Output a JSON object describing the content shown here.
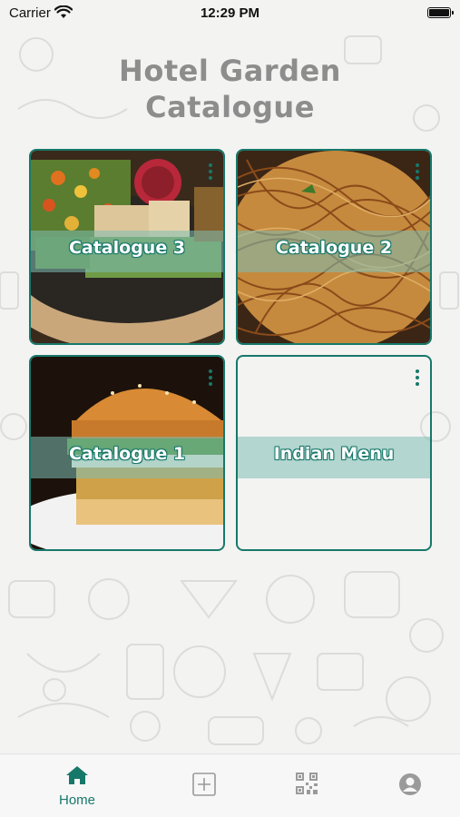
{
  "status_bar": {
    "carrier": "Carrier",
    "time": "12:29 PM"
  },
  "header": {
    "title_line1": "Hotel Garden",
    "title_line2": "Catalogue"
  },
  "catalogues": [
    {
      "label": "Catalogue 3",
      "image": "grilled-vegetable-platter"
    },
    {
      "label": "Catalogue 2",
      "image": "noodles"
    },
    {
      "label": "Catalogue 1",
      "image": "veggie-burger"
    },
    {
      "label": "Indian Menu",
      "image": "none"
    }
  ],
  "tabbar": {
    "items": [
      {
        "label": "Home",
        "icon": "home-icon",
        "active": true
      },
      {
        "label": "",
        "icon": "add-square-icon",
        "active": false
      },
      {
        "label": "",
        "icon": "qr-code-icon",
        "active": false
      },
      {
        "label": "",
        "icon": "profile-icon",
        "active": false
      }
    ]
  },
  "colors": {
    "accent": "#17786a",
    "title": "#8d8d8d",
    "background": "#f3f3f2"
  }
}
